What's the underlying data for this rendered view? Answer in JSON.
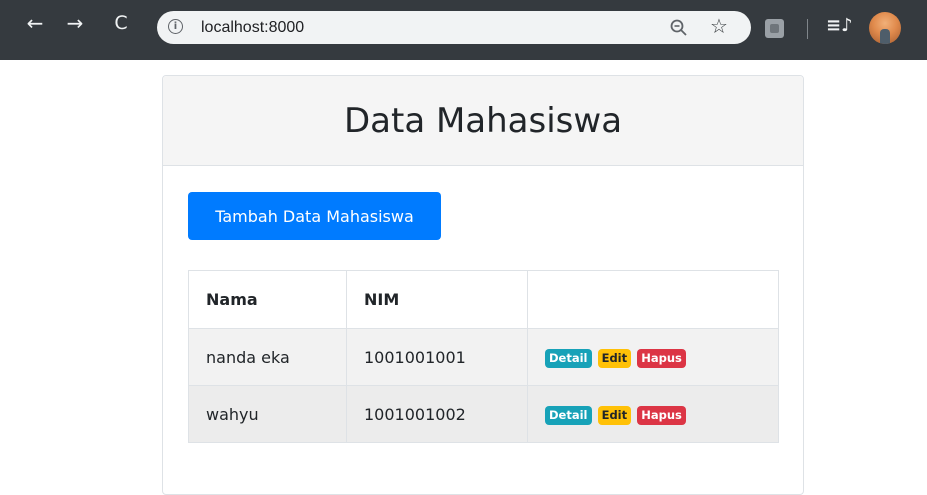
{
  "browser": {
    "url": "localhost:8000",
    "back_glyph": "←",
    "forward_glyph": "→",
    "reload_glyph": "C",
    "info_glyph": "i",
    "star_glyph": "☆",
    "media_glyph": "≡♪"
  },
  "page": {
    "title": "Data Mahasiswa",
    "add_button_label": "Tambah Data Mahasiswa"
  },
  "table": {
    "headers": [
      "Nama",
      "NIM",
      ""
    ],
    "rows": [
      {
        "nama": "nanda eka",
        "nim": "1001001001",
        "actions": [
          "Detail",
          "Edit",
          "Hapus"
        ]
      },
      {
        "nama": "wahyu",
        "nim": "1001001002",
        "actions": [
          "Detail",
          "Edit",
          "Hapus"
        ]
      }
    ]
  },
  "colors": {
    "primary": "#007bff",
    "detail": "#17a2b8",
    "edit": "#ffc107",
    "hapus": "#dc3545",
    "toolbar": "#353a3f"
  }
}
